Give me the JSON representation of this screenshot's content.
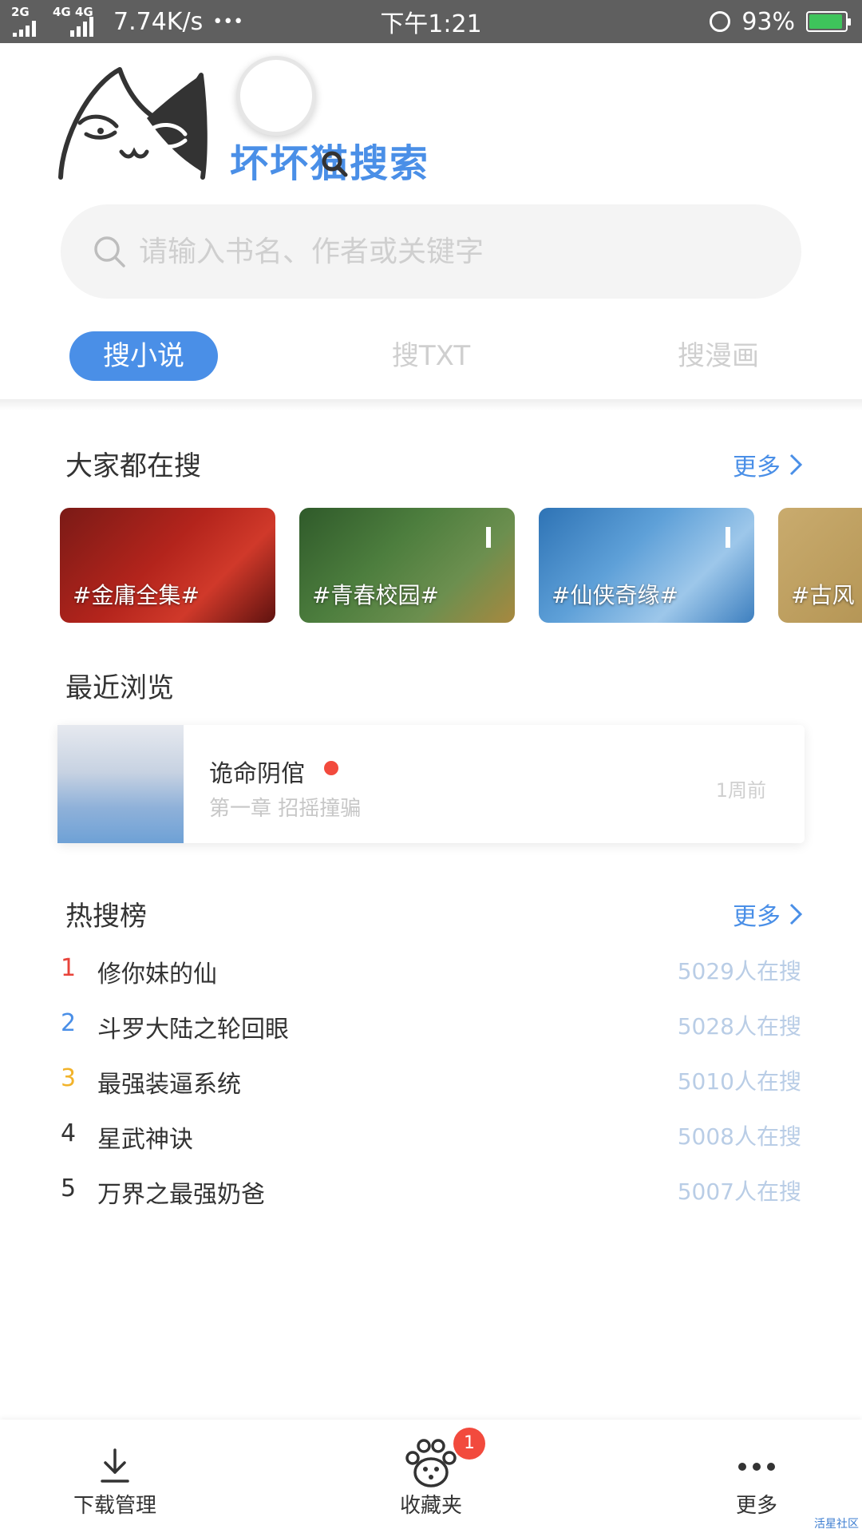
{
  "status_bar": {
    "net1": "2G",
    "net2": "4G 4G",
    "speed": "7.74K/s",
    "dots": "•••",
    "time": "下午1:21",
    "battery": "93%",
    "battery_level": 0.93
  },
  "brand": {
    "name": "坏坏猫搜索"
  },
  "search": {
    "placeholder": "请输入书名、作者或关键字"
  },
  "tabs": [
    "搜小说",
    "搜TXT",
    "搜漫画"
  ],
  "popular": {
    "title": "大家都在搜",
    "more": "更多",
    "topics": [
      "#金庸全集#",
      "#青春校园#",
      "#仙侠奇缘#",
      "#古风"
    ]
  },
  "recent": {
    "title": "最近浏览",
    "book": "诡命阴倌",
    "chapter": "第一章  招摇撞骗",
    "time": "1周前"
  },
  "hot": {
    "title": "热搜榜",
    "more": "更多",
    "items": [
      {
        "rank": "1",
        "name": "修你妹的仙",
        "count": "5029人在搜",
        "color": "#e8433a"
      },
      {
        "rank": "2",
        "name": "斗罗大陆之轮回眼",
        "count": "5028人在搜",
        "color": "#4a8fe7"
      },
      {
        "rank": "3",
        "name": "最强装逼系统",
        "count": "5010人在搜",
        "color": "#f2b32a"
      },
      {
        "rank": "4",
        "name": "星武神诀",
        "count": "5008人在搜",
        "color": "#333333"
      },
      {
        "rank": "5",
        "name": "万界之最强奶爸",
        "count": "5007人在搜",
        "color": "#333333"
      }
    ]
  },
  "bottom_nav": {
    "download": "下载管理",
    "favorites": "收藏夹",
    "favorites_badge": "1",
    "more": "更多"
  },
  "watermark": "活星社区",
  "colors": {
    "accent": "#4a8fe7",
    "status_bar": "#5f5f5f",
    "badge": "#f24a3d"
  }
}
